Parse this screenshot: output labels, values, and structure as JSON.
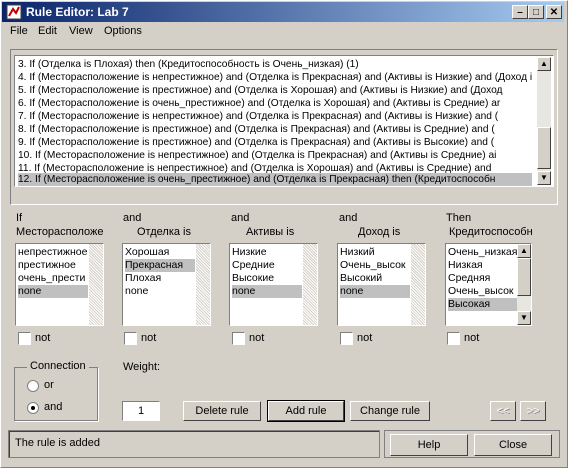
{
  "window": {
    "title": "Rule Editor: Lab 7"
  },
  "menu": [
    "File",
    "Edit",
    "View",
    "Options"
  ],
  "rules": [
    "3. If (Отделка is Плохая) then (Кредитоспособность is Очень_низкая) (1)",
    "4. If (Месторасположение is непрестижное) and (Отделка is Прекрасная) and (Активы is Низкие) and (Доход is",
    "5. If (Месторасположение is престижное) and (Отделка is Хорошая) and (Активы is Низкие) and (Доход",
    "6. If (Месторасположение is очень_престижное) and (Отделка is Хорошая) and (Активы is Средние) ar",
    "7. If (Месторасположение is непрестижное) and (Отделка is Прекрасная) and (Активы is Низкие) and (",
    "8. If (Месторасположение is престижное) and (Отделка is Прекрасная) and (Активы is Средние) and (",
    "9. If (Месторасположение is престижное) and (Отделка is Прекрасная) and (Активы is Высокие) and (",
    "10. If (Месторасположение is непрестижное) and (Отделка is Прекрасная) and (Активы is Средние) ai",
    "11. If (Месторасположение is непрестижное) and (Отделка is Хорошая) and (Активы is Средние) and",
    "12. If (Месторасположение is очень_престижное) and (Отделка is Прекрасная) then (Кредитоспособн"
  ],
  "columns": [
    {
      "conj": "If",
      "name": "Месторасположе",
      "items": [
        "непрестижное",
        "престижное",
        "очень_прести",
        "none"
      ],
      "selected": 3,
      "not": "not"
    },
    {
      "conj": "and",
      "name": "Отделка is",
      "items": [
        "Хорошая",
        "Прекрасная",
        "Плохая",
        "none"
      ],
      "selected": 1,
      "not": "not"
    },
    {
      "conj": "and",
      "name": "Активы is",
      "items": [
        "Низкие",
        "Средние",
        "Высокие",
        "none"
      ],
      "selected": 3,
      "not": "not"
    },
    {
      "conj": "and",
      "name": "Доход is",
      "items": [
        "Низкий",
        "Очень_высок",
        "Высокий",
        "none"
      ],
      "selected": 3,
      "not": "not"
    },
    {
      "conj": "Then",
      "name": "Кредитоспособн",
      "items": [
        "Очень_низкая",
        "Низкая",
        "Средняя",
        "Очень_высок",
        "Высокая"
      ],
      "selected": 4,
      "not": "not"
    }
  ],
  "connection": {
    "label": "Connection",
    "or": "or",
    "and": "and",
    "selected": "and"
  },
  "weight": {
    "label": "Weight:",
    "value": "1"
  },
  "buttons": {
    "delete": "Delete rule",
    "add": "Add rule",
    "change": "Change rule",
    "prev": "<<",
    "next": ">>",
    "help": "Help",
    "close": "Close"
  },
  "status": "The rule is added"
}
